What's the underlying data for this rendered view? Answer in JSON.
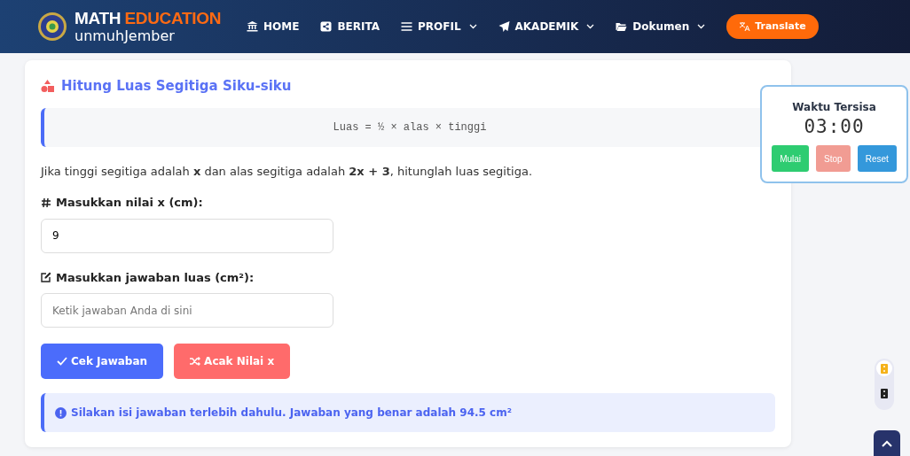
{
  "navbar": {
    "logo": {
      "title_1": "MATH",
      "title_2": "EDUCATION",
      "subtitle": "unmuhJember"
    },
    "items": [
      {
        "label": "HOME",
        "dropdown": false
      },
      {
        "label": "BERITA",
        "dropdown": false
      },
      {
        "label": "PROFIL",
        "dropdown": true
      },
      {
        "label": "AKADEMIK",
        "dropdown": true
      },
      {
        "label": "Dokumen",
        "dropdown": true
      }
    ],
    "translate_button": "Translate"
  },
  "card": {
    "title": "Hitung Luas Segitiga Siku-siku",
    "formula": "Luas = ½ × alas × tinggi",
    "question": "Jika tinggi segitiga adalah **x** dan alas segitiga adalah **2x + 3**, hitunglah luas segitiga.",
    "fields": [
      {
        "label": "Masukkan nilai x (cm):",
        "value": "9"
      },
      {
        "label": "Masukkan jawaban luas (cm²):",
        "placeholder": "Ketik jawaban Anda di sini"
      }
    ],
    "buttons": [
      {
        "label": "Cek Jawaban",
        "kind": "check"
      },
      {
        "label": "Acak Nilai x",
        "kind": "shuffle"
      }
    ],
    "alert": "Silakan isi jawaban terlebih dahulu. Jawaban yang benar adalah 94.5 cm²"
  },
  "timer": {
    "title": "Waktu Tersisa",
    "time": "03:00",
    "buttons": [
      {
        "label": "Mulai",
        "kind": "start",
        "disabled": false
      },
      {
        "label": "Stop",
        "kind": "stop",
        "disabled": true
      },
      {
        "label": "Reset",
        "kind": "reset",
        "disabled": false
      }
    ]
  },
  "theme_toggle": [
    {
      "selected": true
    },
    {
      "selected": false
    }
  ]
}
